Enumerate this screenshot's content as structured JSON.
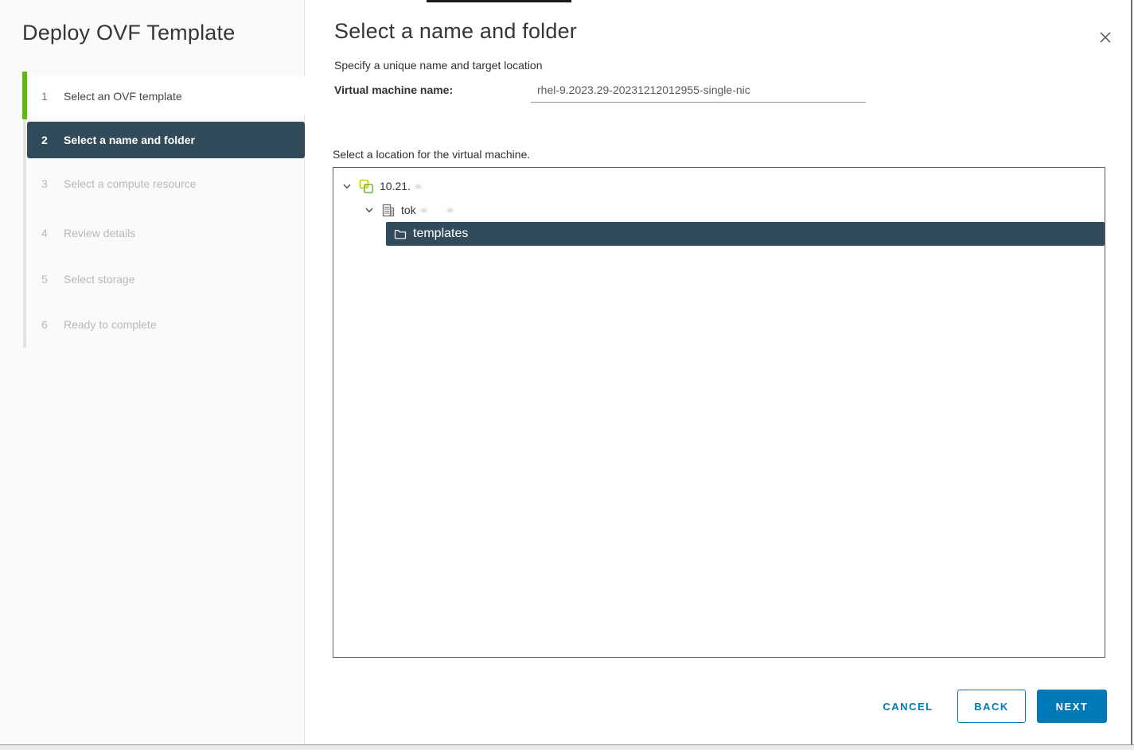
{
  "dialog": {
    "title": "Deploy OVF Template",
    "steps": [
      {
        "number": "1",
        "label": "Select an OVF template",
        "state": "completed"
      },
      {
        "number": "2",
        "label": "Select a name and folder",
        "state": "active"
      },
      {
        "number": "3",
        "label": "Select a compute resource",
        "state": "disabled"
      },
      {
        "number": "4",
        "label": "Review details",
        "state": "disabled"
      },
      {
        "number": "5",
        "label": "Select storage",
        "state": "disabled"
      },
      {
        "number": "6",
        "label": "Ready to complete",
        "state": "disabled"
      }
    ]
  },
  "content": {
    "heading": "Select a name and folder",
    "subheading": "Specify a unique name and target location",
    "vm_name_label": "Virtual machine name:",
    "vm_name_value": "rhel-9.2023.29-20231212012955-single-nic",
    "location_label": "Select a location for the virtual machine.",
    "tree": [
      {
        "level": 1,
        "expanded": true,
        "icon": "vcenter-icon",
        "label": "10.21.",
        "selected": false
      },
      {
        "level": 2,
        "expanded": true,
        "icon": "datacenter-icon",
        "label": "tok",
        "selected": false
      },
      {
        "level": 3,
        "icon": "folder-icon",
        "label": "templates",
        "selected": true
      }
    ]
  },
  "footer": {
    "cancel_label": "CANCEL",
    "back_label": "BACK",
    "next_label": "NEXT"
  },
  "colors": {
    "accent_blue": "#0079b8",
    "active_step_bg": "#324b5a",
    "selected_row_bg": "#324b5a",
    "progress_green": "#61b715",
    "sidebar_bg": "#fafafa"
  }
}
